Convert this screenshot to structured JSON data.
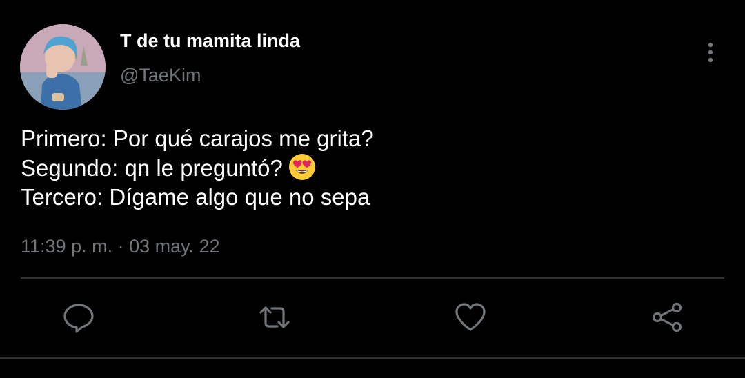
{
  "tweet": {
    "display_name": "T de tu mamita linda",
    "handle": "@TaeKim",
    "lines": [
      "Primero: Por qué carajos me grita?",
      "Segundo: qn le preguntó?",
      "Tercero: Dígame algo que no sepa"
    ],
    "timestamp": "11:39 p. m. · 03 may. 22"
  },
  "icons": {
    "more": "more-vertical-icon",
    "reply": "reply-icon",
    "retweet": "retweet-icon",
    "like": "heart-icon",
    "share": "share-icon",
    "emoji": "heart-eyes-emoji-icon"
  },
  "colors": {
    "background": "#000000",
    "primary_text": "#ffffff",
    "secondary_text": "#71767b",
    "icon": "#71767b",
    "divider": "#2f3336"
  }
}
